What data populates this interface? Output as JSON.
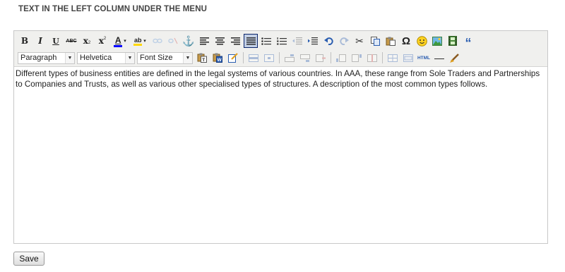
{
  "page": {
    "section_title": "TEXT IN THE LEFT COLUMN UNDER THE MENU"
  },
  "toolbar": {
    "bold": "B",
    "italic": "I",
    "underline": "U",
    "strikethrough": "ABC",
    "subscript": "x",
    "superscript": "x",
    "font_color": "A",
    "highlight": "ab",
    "anchor": "⚓",
    "omega": "Ω",
    "smiley": "☺",
    "blockquote": "“",
    "html": "HTML",
    "hr": "—",
    "format_select": "Paragraph",
    "font_select": "Helvetica",
    "size_select": "Font Size"
  },
  "editor": {
    "content": "Different types of business entities are defined in the legal systems of various countries. In AAA, these range from Sole Traders and Partnerships to Companies and Trusts, as well as various other specialised types of structures. A description of the most common types follows."
  },
  "actions": {
    "save_label": "Save"
  },
  "colors": {
    "toolbar_bg": "#f0f0ee",
    "active_bg": "#c2cfe5",
    "title_color": "#444444"
  }
}
